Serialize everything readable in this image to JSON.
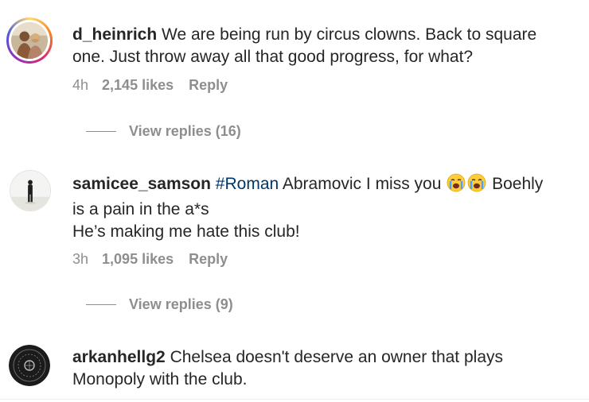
{
  "comments": [
    {
      "username": "d_heinrich",
      "line1": " We are being run by circus clowns. Back to square",
      "line2": "one. Just throw away all that good progress, for what?",
      "time": "4h",
      "likes": "2,145 likes",
      "reply": "Reply",
      "view_replies": "View replies (16)",
      "avatar_icon": "profile-photo-couple",
      "has_story_ring": true
    },
    {
      "username": "samicee_samson",
      "hashtag": "#Roman",
      "line1_after_hashtag": " Abramovic I miss you ",
      "line1_after_emojis": " Boehly",
      "line2": "is a pain in the a*s",
      "line3": "He’s making me hate this club!",
      "emoji": "loudly-crying-face-emoji",
      "time": "3h",
      "likes": "1,095 likes",
      "reply": "Reply",
      "view_replies": "View replies (9)",
      "avatar_icon": "profile-photo-person-standing",
      "has_story_ring": false
    },
    {
      "username": "arkanhellg2",
      "line1": " Chelsea doesn't deserve an owner that plays",
      "line2": "Monopoly with the club.",
      "avatar_icon": "dark-circle-logo",
      "has_story_ring": false
    }
  ],
  "colors": {
    "username": "#262626",
    "body_text": "#262626",
    "meta_text": "#8e8e8e",
    "hashtag": "#00376b",
    "story_ring_start": "#feda75",
    "story_ring_end": "#962fbf"
  }
}
